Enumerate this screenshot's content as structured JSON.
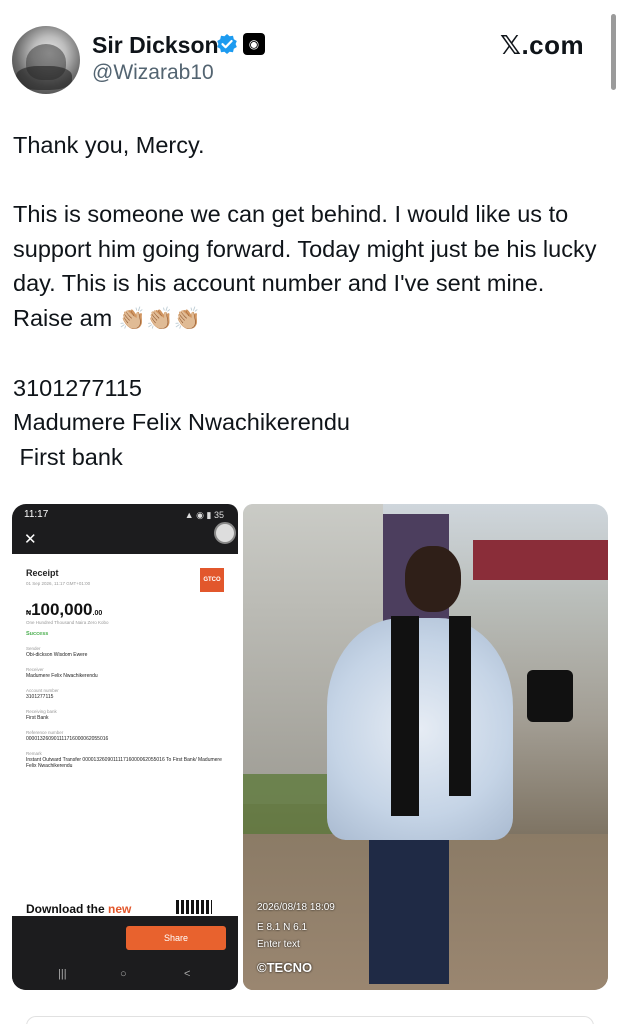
{
  "header": {
    "display_name": "Sir Dickson",
    "handle": "@Wizarab10",
    "site": "𝕏.com"
  },
  "tweet": {
    "line1": "Thank you, Mercy.",
    "para1": "This is someone we can get behind. I would like us to support him going forward. Today might just be his lucky day. This is his account number and I've sent mine. Raise am",
    "claps": "👏🏼👏🏼👏🏼",
    "account_number": "3101277115",
    "account_name": "Madumere Felix Nwachikerendu",
    "bank": " First bank"
  },
  "receipt": {
    "status_time": "11:17",
    "status_right": "▲ ◉ ▮ 35",
    "close": "✕",
    "title": "Receipt",
    "date": "01 Sep 2026, 11:17 GMT+01:00",
    "gtco": "GTCO",
    "amount_prefix": "₦",
    "amount": "100,000",
    "amount_decimals": ".00",
    "amount_words": "One Hundred Thousand Naira Zero Kobo",
    "status": "Success",
    "sender_label": "Sender",
    "sender": "Obi-dickson Wisdom Ewere",
    "receiver_label": "Receiver",
    "receiver": "Madumere Felix Nwachikerendu",
    "account_label": "Account number",
    "account": "3101277115",
    "bank_label": "Receiving bank",
    "bank": "First Bank",
    "reference_label": "Reference number",
    "reference": "000013260901111716000062055016",
    "remark_label": "Remark",
    "remark": "Instant Outward Transfer 000013260901111716000062055016 To First Bank/ Madumere Felix Nwachikerendu",
    "download_prefix": "Download the ",
    "download_new": "new",
    "share": "Share",
    "nav_recent": "|||",
    "nav_home": "○",
    "nav_back": "<"
  },
  "photo": {
    "timestamp": "2026/08/18 18:09",
    "coords": "E 8.1 N 6.1",
    "enter_text": "Enter text",
    "brand": "©TECNO"
  },
  "colors": {
    "text": "#0f1419",
    "secondary": "#536471",
    "verified": "#1d9bf0",
    "gtco": "#e2572c"
  }
}
